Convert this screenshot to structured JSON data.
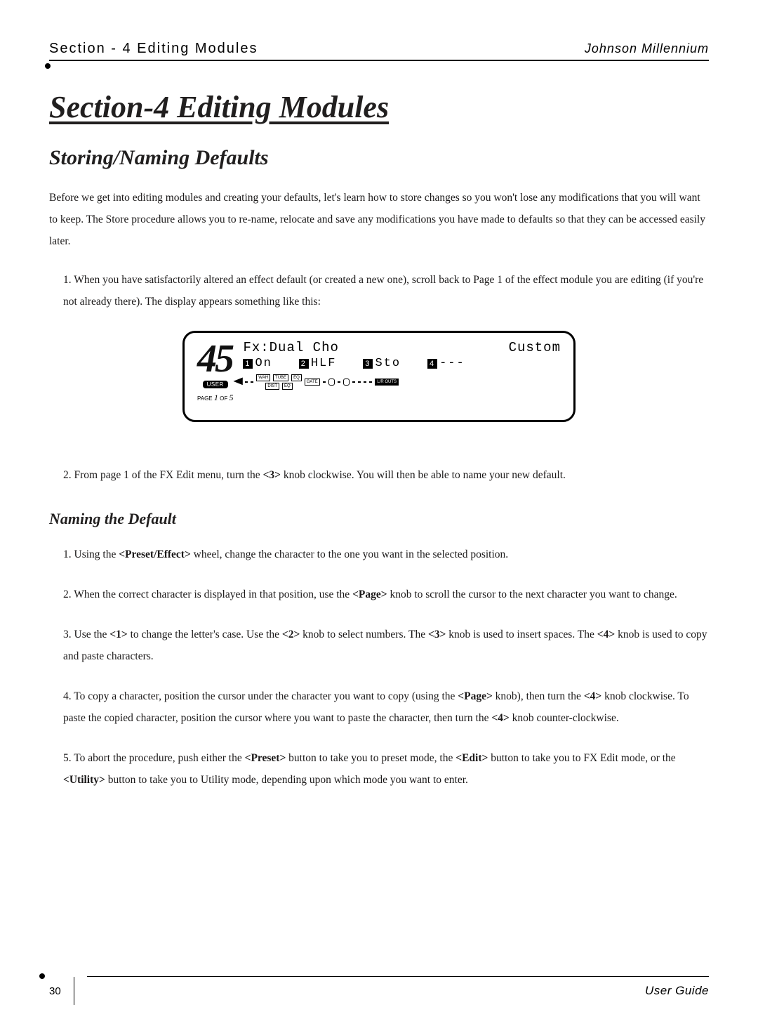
{
  "header": {
    "left": "Section - 4   Editing Modules",
    "right": "Johnson Millennium"
  },
  "section_title": "Section-4 Editing Modules",
  "storing_title": "Storing/Naming Defaults",
  "intro": "Before we get into editing modules and creating your defaults, let's learn how to store changes so you won't lose any modifications that you will want to keep. The Store procedure allows you to re-name, relocate and save any modifications you have made to defaults so that they can be accessed easily later.",
  "step1": "1. When you have satisfactorily altered an effect default (or created a new one), scroll back to Page 1 of the effect module you are editing (if you're not already there). The display appears something like this:",
  "display": {
    "big_number": "45",
    "user_badge": "USER",
    "page_word": "PAGE",
    "page_cur": "1",
    "page_of_word": "OF",
    "page_total": "5",
    "line1_left": "Fx:Dual Cho",
    "line1_right": "Custom",
    "p1_num": "1",
    "p1_val": "On",
    "p2_num": "2",
    "p2_val": "HLF",
    "p3_num": "3",
    "p3_val": "Sto",
    "p4_num": "4",
    "p4_val": "---",
    "chain": {
      "b1": "WAH",
      "b2": "TUBE",
      "b3": "EQ",
      "b4": "GATE",
      "b5": "DIST",
      "b6": "EQ",
      "out": "L/R OUTS"
    }
  },
  "step2_pre": "2.  From page 1 of the FX Edit menu, turn the ",
  "step2_key": "<3>",
  "step2_post": " knob clockwise. You will then be able to name your new default.",
  "naming_title": "Naming the Default",
  "n1_pre": "1. Using the ",
  "n1_key": "<Preset/Effect>",
  "n1_post": " wheel, change the character to the one you want in the selected position.",
  "n2_pre": "2. When the correct character is displayed in that position, use the ",
  "n2_key": "<Page>",
  "n2_post": " knob to scroll the cursor to the next character you want to change.",
  "n3_a": "3. Use the ",
  "n3_k1": "<1>",
  "n3_b": " to change the letter's case. Use the ",
  "n3_k2": "<2>",
  "n3_c": " knob to select numbers.  The ",
  "n3_k3": "<3>",
  "n3_d": " knob is used to insert spaces. The ",
  "n3_k4": "<4>",
  "n3_e": " knob is used to copy and paste characters.",
  "n4_a": "4. To copy a character, position the cursor under the character you want to copy (using the ",
  "n4_k1": "<Page>",
  "n4_b": " knob), then turn the ",
  "n4_k2": "<4>",
  "n4_c": " knob clockwise.  To paste the copied character, position the cursor where you want to paste the character, then turn the ",
  "n4_k3": "<4>",
  "n4_d": " knob counter-clockwise.",
  "n5_a": "5. To abort the procedure, push either the ",
  "n5_k1": "<Preset>",
  "n5_b": " button to take you to preset mode, the ",
  "n5_k2": "<Edit>",
  "n5_c": " button to take you to FX Edit mode, or the ",
  "n5_k3": "<Utility>",
  "n5_d": " button to take you to Utility mode, depending upon which mode you want to enter.",
  "footer": {
    "page": "30",
    "guide": "User Guide"
  }
}
